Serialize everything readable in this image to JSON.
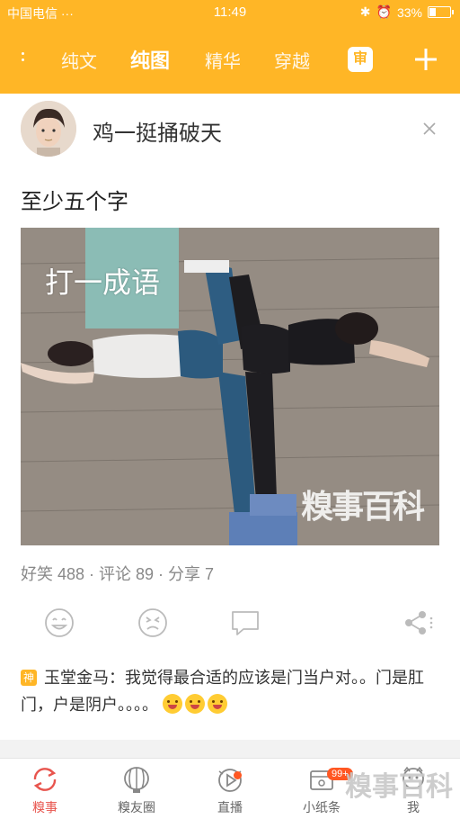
{
  "statusbar": {
    "carrier": "中国电信 ···",
    "time": "11:49",
    "battery": "33%",
    "battery_level": 0.33
  },
  "tabs": [
    {
      "label": "纯文",
      "active": false
    },
    {
      "label": "纯图",
      "active": true
    },
    {
      "label": "精华",
      "active": false
    },
    {
      "label": "穿越",
      "active": false
    }
  ],
  "header": {
    "review_label": "审",
    "accent_color": "#ffb626"
  },
  "post": {
    "username": "鸡一挺捅破天",
    "title": "至少五个字",
    "image_overlay_text": "打一成语",
    "image_watermark": "糗事百科",
    "stats": "好笑 488 · 评论 89 · 分享 7"
  },
  "god_comment": {
    "badge": "神",
    "author": "玉堂金马",
    "separator": "：",
    "text": "我觉得最合适的应该是门当户对。。门是肛门，户是阴户。。。。",
    "emoji_count": 3
  },
  "bottom_nav": [
    {
      "label": "糗事",
      "icon": "refresh-icon",
      "active": true
    },
    {
      "label": "糗友圈",
      "icon": "lantern-icon",
      "active": false
    },
    {
      "label": "直播",
      "icon": "live-play-icon",
      "active": false
    },
    {
      "label": "小纸条",
      "icon": "message-box-icon",
      "active": false,
      "badge": "99+"
    },
    {
      "label": "我",
      "icon": "profile-icon",
      "active": false
    }
  ],
  "nav_watermark": "糗事百科"
}
